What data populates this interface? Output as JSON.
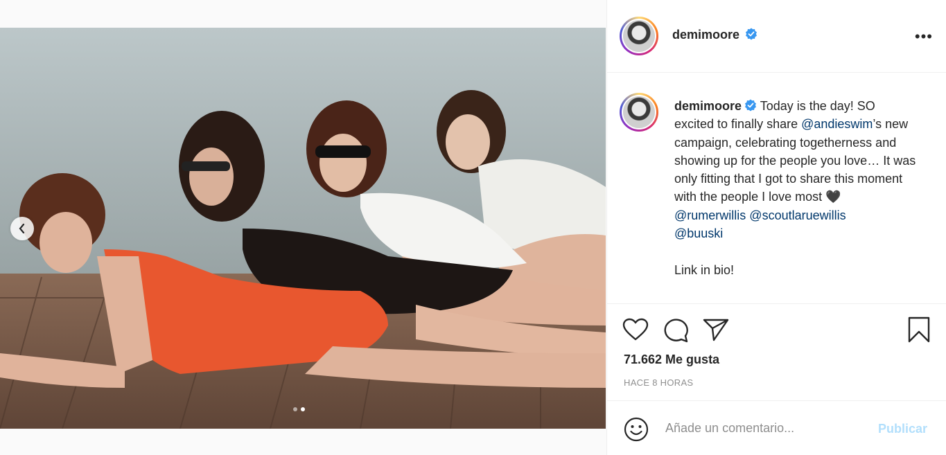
{
  "post": {
    "username": "demimoore",
    "verified": true,
    "caption_segments": [
      {
        "type": "text",
        "value": "Today is the day! SO excited to finally share "
      },
      {
        "type": "mention",
        "value": "@andieswim"
      },
      {
        "type": "text",
        "value": "’s new campaign, celebrating togetherness and showing up for the people you love… It was only fitting that I got to share this moment with the people I love most 🖤 "
      },
      {
        "type": "mention",
        "value": "@rumerwillis"
      },
      {
        "type": "text",
        "value": " "
      },
      {
        "type": "mention",
        "value": "@scoutlaruewillis"
      },
      {
        "type": "text",
        "value": " "
      },
      {
        "type": "mention",
        "value": "@buuski"
      }
    ],
    "caption_footer": "Link in bio!",
    "likes": "71.662 Me gusta",
    "time": "HACE 8 HORAS",
    "carousel": {
      "current": 2,
      "total": 2
    }
  },
  "comment": {
    "placeholder": "Añade un comentario...",
    "publish_label": "Publicar"
  },
  "icons": {
    "more": "more-options-icon",
    "like": "heart-icon",
    "comment": "comment-icon",
    "share": "share-icon",
    "save": "bookmark-icon",
    "emoji": "emoji-icon",
    "verified": "verified-badge-icon",
    "prev": "chevron-left-icon"
  },
  "colors": {
    "verified_blue": "#3897f0",
    "mention": "#00376b",
    "publish_disabled": "#b2dffc",
    "muted": "#8e8e8e"
  }
}
